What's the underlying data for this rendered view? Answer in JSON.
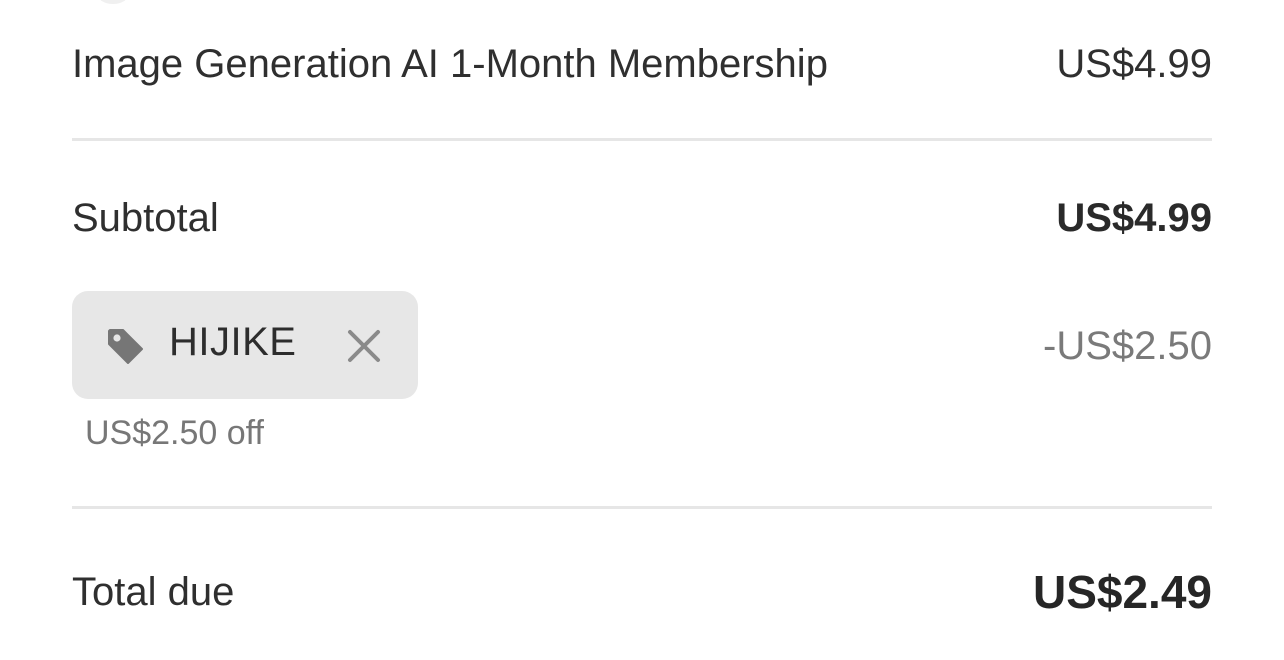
{
  "order_summary": {
    "line_item": {
      "name": "Image Generation AI 1-Month Membership",
      "price": "US$4.99"
    },
    "subtotal": {
      "label": "Subtotal",
      "value": "US$4.99"
    },
    "promo": {
      "code": "HIJIKE",
      "icon": "tag-icon",
      "remove_icon": "close-icon",
      "discount_amount": "-US$2.50",
      "note": "US$2.50 off"
    },
    "total": {
      "label": "Total due",
      "value": "US$2.49"
    }
  },
  "colors": {
    "chip_background": "#e7e7e7",
    "divider": "#e6e6e6",
    "muted_text": "#7a7a7a",
    "primary_text": "#2f2f2f"
  }
}
